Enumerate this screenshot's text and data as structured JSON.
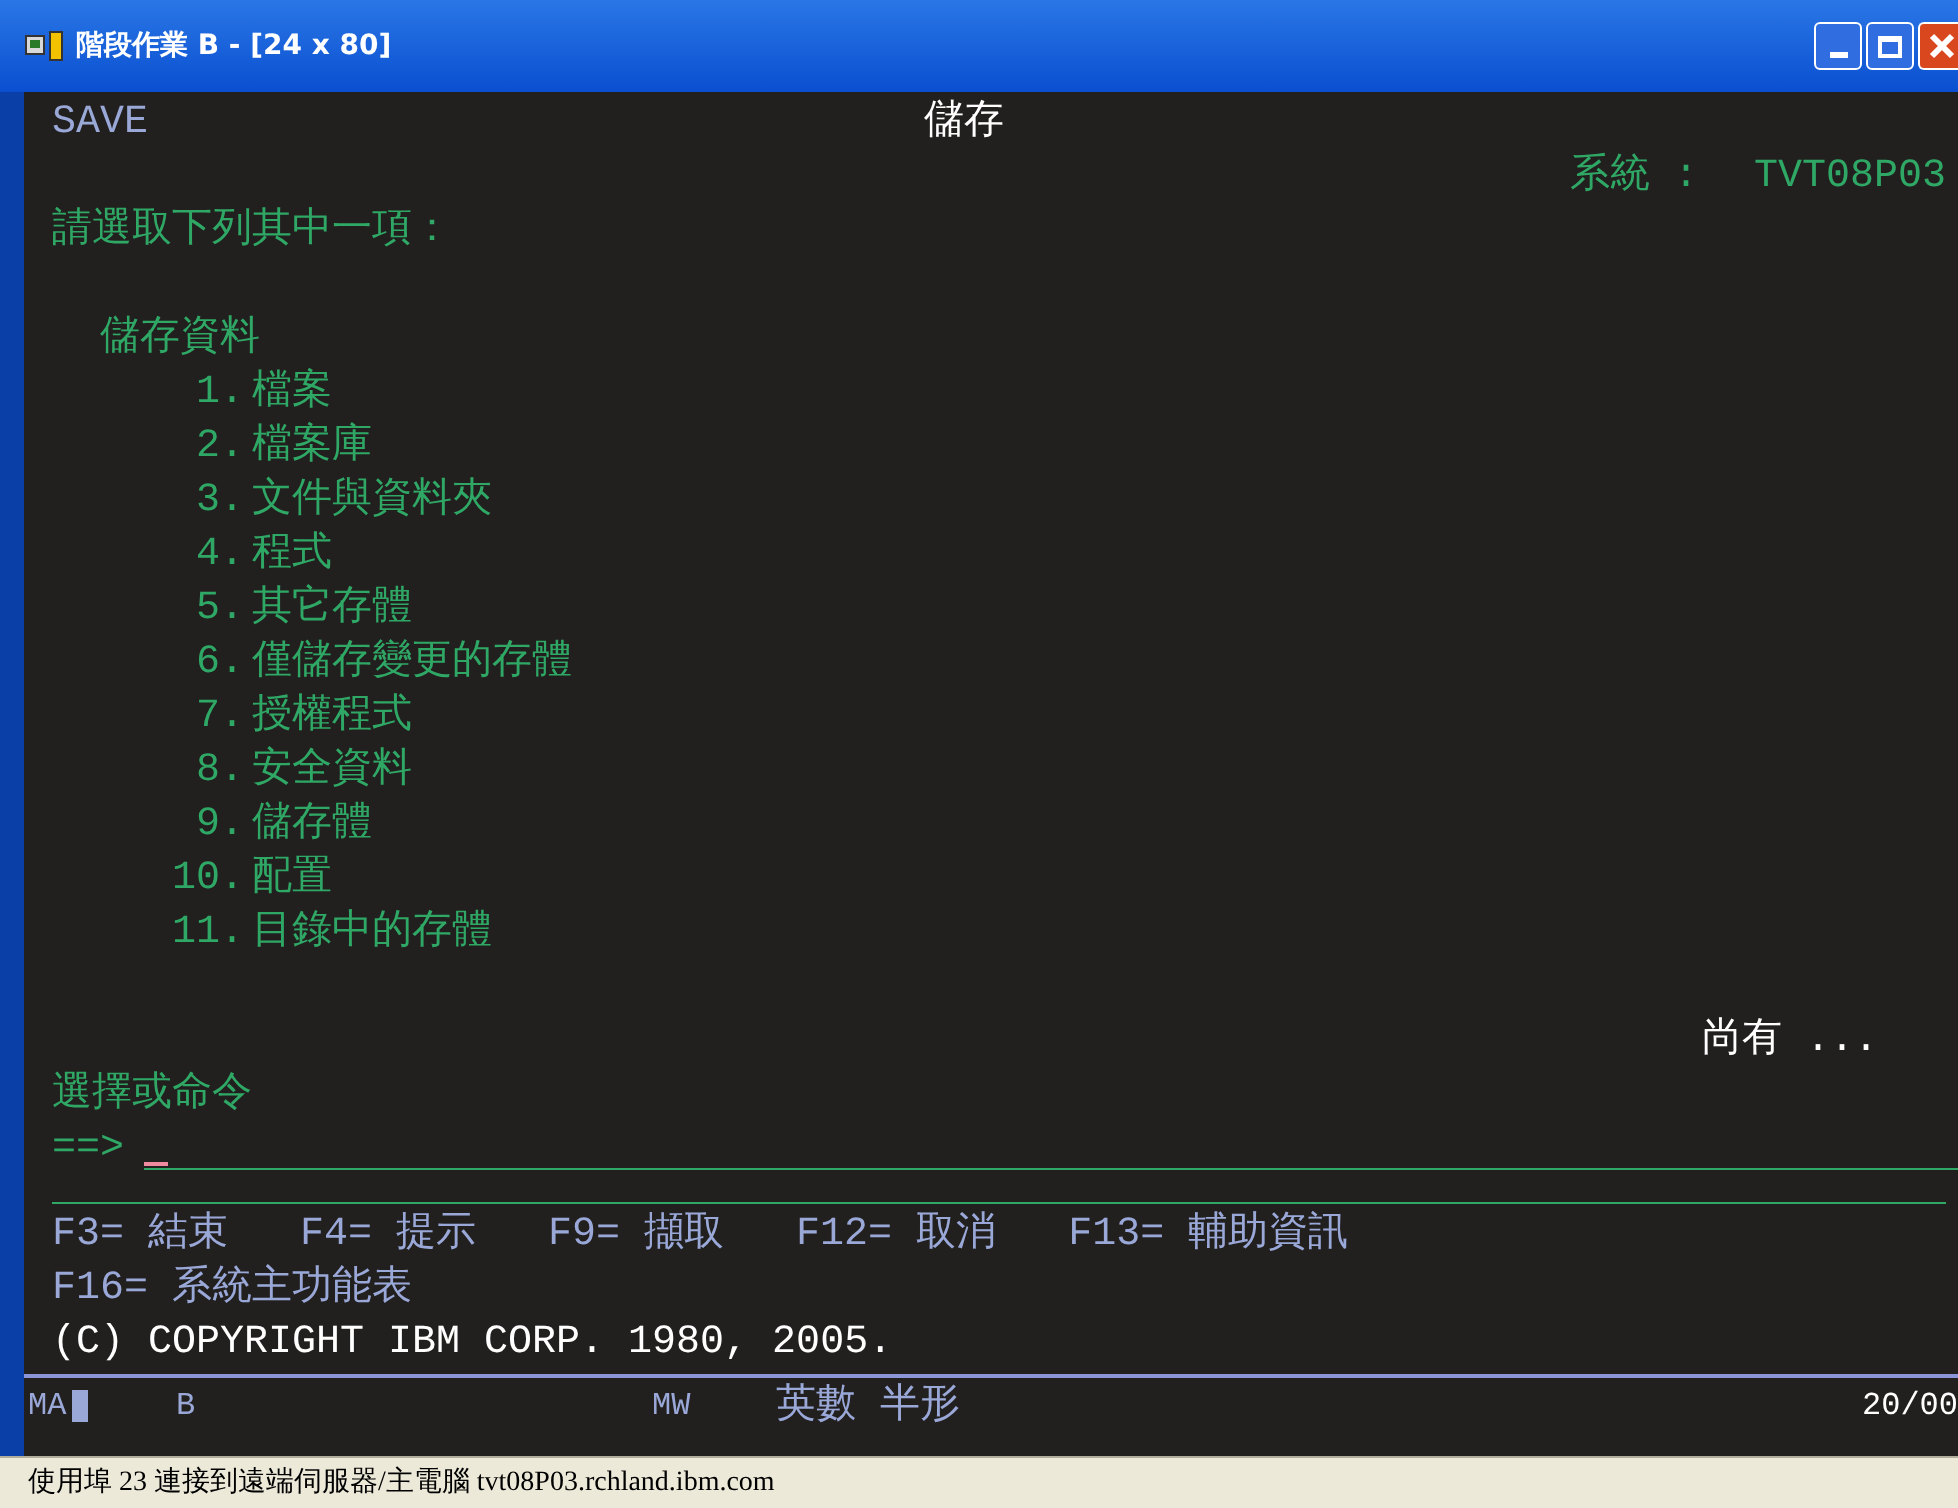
{
  "window": {
    "title": "階段作業 B - [24 x 80]"
  },
  "screen": {
    "id": "SAVE",
    "title": "儲存",
    "system_label": "系統 :",
    "system_name": "TVT08P03",
    "instruction": "請選取下列其中一項：",
    "group": "儲存資料",
    "options": [
      {
        "number": "1.",
        "label": "檔案"
      },
      {
        "number": "2.",
        "label": "檔案庫"
      },
      {
        "number": "3.",
        "label": "文件與資料夾"
      },
      {
        "number": "4.",
        "label": "程式"
      },
      {
        "number": "5.",
        "label": "其它存體"
      },
      {
        "number": "6.",
        "label": "僅儲存變更的存體"
      },
      {
        "number": "7.",
        "label": "授權程式"
      },
      {
        "number": "8.",
        "label": "安全資料"
      },
      {
        "number": "9.",
        "label": "儲存體"
      },
      {
        "number": "10.",
        "label": "配置"
      },
      {
        "number": "11.",
        "label": "目錄中的存體"
      }
    ],
    "more": "尚有 ...",
    "command_label": "選擇或命令",
    "prompt": "==>",
    "function_keys": [
      [
        "F3= 結束",
        "F4= 提示",
        "F9= 擷取",
        "F12= 取消",
        "F13= 輔助資訊"
      ],
      [
        "F16= 系統主功能表"
      ]
    ],
    "copyright": "(C) COPYRIGHT IBM CORP. 1980, 2005."
  },
  "operator_info": {
    "session": "MA",
    "mode": "B",
    "input": "MW",
    "keyboard": "英數 半形",
    "cursor_position": "20/00"
  },
  "status_bar": "使用埠 23 連接到遠端伺服器/主電腦 tvt08P03.rchland.ibm.com"
}
